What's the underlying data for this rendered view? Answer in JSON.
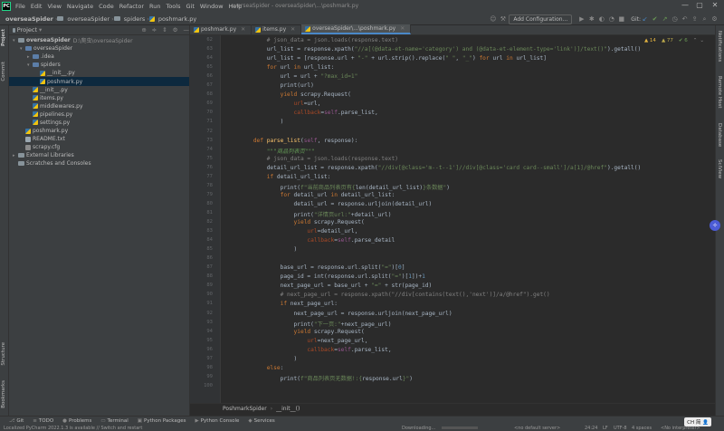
{
  "menubar": {
    "logo": "PC",
    "items": [
      "File",
      "Edit",
      "View",
      "Navigate",
      "Code",
      "Refactor",
      "Run",
      "Tools",
      "Git",
      "Window",
      "Help"
    ],
    "window_title": "overseaSpider - overseaSpider\\...\\poshmark.py"
  },
  "navbar": {
    "crumbs": [
      "overseaSpider",
      "overseaSpider",
      "spiders",
      "poshmark.py"
    ],
    "config_button": "Add Configuration...",
    "git_label": "Git:"
  },
  "project": {
    "title": "Project",
    "tree": [
      {
        "indent": 0,
        "arrow": "▾",
        "icon": "fold",
        "label": "overseaSpider",
        "dim": "D:\\爬虫\\overseaSpider",
        "bold": true
      },
      {
        "indent": 1,
        "arrow": "▾",
        "icon": "fold",
        "label": "overseaSpider"
      },
      {
        "indent": 2,
        "arrow": "▸",
        "icon": "fold",
        "label": ".idea"
      },
      {
        "indent": 2,
        "arrow": "▾",
        "icon": "fold",
        "label": "spiders"
      },
      {
        "indent": 3,
        "arrow": "",
        "icon": "py",
        "label": "__init__.py"
      },
      {
        "indent": 3,
        "arrow": "",
        "icon": "py",
        "label": "poshmark.py",
        "selected": true
      },
      {
        "indent": 2,
        "arrow": "",
        "icon": "py",
        "label": "__init__.py"
      },
      {
        "indent": 2,
        "arrow": "",
        "icon": "py",
        "label": "items.py"
      },
      {
        "indent": 2,
        "arrow": "",
        "icon": "py",
        "label": "middlewares.py"
      },
      {
        "indent": 2,
        "arrow": "",
        "icon": "py",
        "label": "pipelines.py"
      },
      {
        "indent": 2,
        "arrow": "",
        "icon": "py",
        "label": "settings.py"
      },
      {
        "indent": 1,
        "arrow": "",
        "icon": "py",
        "label": "poshmark.py"
      },
      {
        "indent": 1,
        "arrow": "",
        "icon": "txt",
        "label": "README.txt"
      },
      {
        "indent": 1,
        "arrow": "",
        "icon": "cfg",
        "label": "scrapy.cfg"
      },
      {
        "indent": 0,
        "arrow": "▸",
        "icon": "fold",
        "label": "External Libraries"
      },
      {
        "indent": 0,
        "arrow": "",
        "icon": "fold",
        "label": "Scratches and Consoles"
      }
    ]
  },
  "leftstrip": [
    "Project",
    "Commit",
    "Structure",
    "Bookmarks"
  ],
  "rightstrip": [
    "Notifications",
    "Remote Host",
    "Database",
    "SciView"
  ],
  "tabs": [
    {
      "label": "poshmark.py",
      "active": false
    },
    {
      "label": "items.py",
      "active": false
    },
    {
      "label": "overseaSpider\\...\\poshmark.py",
      "active": true
    }
  ],
  "inspections": {
    "warn": "▲ 14",
    "weak": "▲ 77",
    "ok": "✔ 6"
  },
  "editor": {
    "lines": [
      {
        "n": "62",
        "h": "            <span class=\"cm\"># json_data = json.loads(response.text)</span>"
      },
      {
        "n": "63",
        "h": "            url_list = response.xpath(<span class=\"st\">\"//a[(@data-et-name='category') and (@data-et-element-type='link')]/text()\"</span>).getall()"
      },
      {
        "n": "64",
        "h": "            url_list = [response.url + <span class=\"st\">\"-\"</span> + url.strip().replace(<span class=\"st\">\" \"</span>, <span class=\"st\">\"_\"</span>) <span class=\"kw\">for</span> url <span class=\"kw\">in</span> url_list]"
      },
      {
        "n": "65",
        "h": "            <span class=\"kw\">for</span> url <span class=\"kw\">in</span> url_list:"
      },
      {
        "n": "66",
        "h": "                url = url + <span class=\"st\">\"?max_id=1\"</span>"
      },
      {
        "n": "67",
        "h": "                print(url)"
      },
      {
        "n": "68",
        "h": "                <span class=\"kw\">yield</span> scrapy.Request("
      },
      {
        "n": "69",
        "h": "                    <span class=\"pa\">url</span>=url,"
      },
      {
        "n": "70",
        "h": "                    <span class=\"pa\">callback</span>=<span class=\"sf\">self</span>.parse_list,"
      },
      {
        "n": "71",
        "h": "                )"
      },
      {
        "n": "72",
        "h": ""
      },
      {
        "n": "73",
        "h": "        <span class=\"kw\">def</span> <span class=\"fn\">parse_list</span>(<span class=\"sf\">self</span>, response):"
      },
      {
        "n": "74",
        "h": "            <span class=\"sd\">\"\"\"商品列表页\"\"\"</span>"
      },
      {
        "n": "75",
        "h": "            <span class=\"cm\"># json_data = json.loads(response.text)</span>"
      },
      {
        "n": "76",
        "h": "            detail_url_list = response.xpath(<span class=\"st\">\"//div[@class='m--t--1']//div[@class='card card--small']/a[1]/@href\"</span>).getall()"
      },
      {
        "n": "77",
        "h": "            <span class=\"kw\">if</span> detail_url_list:"
      },
      {
        "n": "78",
        "h": "                print(<span class=\"st\">f\"当前商品列表页有{</span>len(detail_url_list)<span class=\"st\">}条数据\"</span>)"
      },
      {
        "n": "79",
        "h": "                <span class=\"kw\">for</span> detail_url <span class=\"kw\">in</span> detail_url_list:"
      },
      {
        "n": "80",
        "h": "                    detail_url = response.urljoin(detail_url)"
      },
      {
        "n": "81",
        "h": "                    print(<span class=\"st\">\"详情页url:\"</span>+detail_url)"
      },
      {
        "n": "82",
        "h": "                    <span class=\"kw\">yield</span> scrapy.Request("
      },
      {
        "n": "83",
        "h": "                        <span class=\"pa\">url</span>=detail_url,"
      },
      {
        "n": "84",
        "h": "                        <span class=\"pa\">callback</span>=<span class=\"sf\">self</span>.parse_detail"
      },
      {
        "n": "85",
        "h": "                    )"
      },
      {
        "n": "86",
        "h": ""
      },
      {
        "n": "87",
        "h": "                base_url = response.url.split(<span class=\"st\">\"=\"</span>)[<span class=\"nm\">0</span>]"
      },
      {
        "n": "88",
        "h": "                page_id = int(response.url.split(<span class=\"st\">\"=\"</span>)[<span class=\"nm\">1</span>])+<span class=\"nm\">1</span>"
      },
      {
        "n": "89",
        "h": "                next_page_url = base_url + <span class=\"st\">\"=\"</span> + str(page_id)"
      },
      {
        "n": "90",
        "h": "                <span class=\"cm\"># next_page_url = response.xpath(\"//div[contains(text(),'next')]/a/@href\").get()</span>"
      },
      {
        "n": "91",
        "h": "                <span class=\"kw\">if</span> next_page_url:"
      },
      {
        "n": "92",
        "h": "                    next_page_url = response.urljoin(next_page_url)"
      },
      {
        "n": "93",
        "h": "                    print(<span class=\"st\">\"下一页:\"</span>+next_page_url)"
      },
      {
        "n": "94",
        "h": "                    <span class=\"kw\">yield</span> scrapy.Request("
      },
      {
        "n": "95",
        "h": "                        <span class=\"pa\">url</span>=next_page_url,"
      },
      {
        "n": "96",
        "h": "                        <span class=\"pa\">callback</span>=<span class=\"sf\">self</span>.parse_list,"
      },
      {
        "n": "97",
        "h": "                    )"
      },
      {
        "n": "98",
        "h": "            <span class=\"kw\">else</span>:"
      },
      {
        "n": "99",
        "h": "                print(<span class=\"st\">f\"商品列表页无数据!:{</span>response.url<span class=\"st\">}\"</span>)"
      },
      {
        "n": "100",
        "h": ""
      }
    ]
  },
  "breadcrumb_bottom": [
    "PoshmarkSpider",
    "›",
    "__init__()"
  ],
  "toolwindows": [
    {
      "icon": "⎇",
      "label": "Git"
    },
    {
      "icon": "≡",
      "label": "TODO"
    },
    {
      "icon": "●",
      "label": "Problems"
    },
    {
      "icon": "▭",
      "label": "Terminal"
    },
    {
      "icon": "▣",
      "label": "Python Packages"
    },
    {
      "icon": "▶",
      "label": "Python Console"
    },
    {
      "icon": "◆",
      "label": "Services"
    }
  ],
  "status": {
    "message": "Localized PyCharm 2022.1.3 is available // Switch and restart",
    "downloading": "Downloading...",
    "vcs": "<no default server>",
    "position": "24:24",
    "lf": "LF",
    "encoding": "UTF-8",
    "indent": "4 spaces",
    "interpreter": "<No interpreter>",
    "ime": "CH 简 👤"
  }
}
